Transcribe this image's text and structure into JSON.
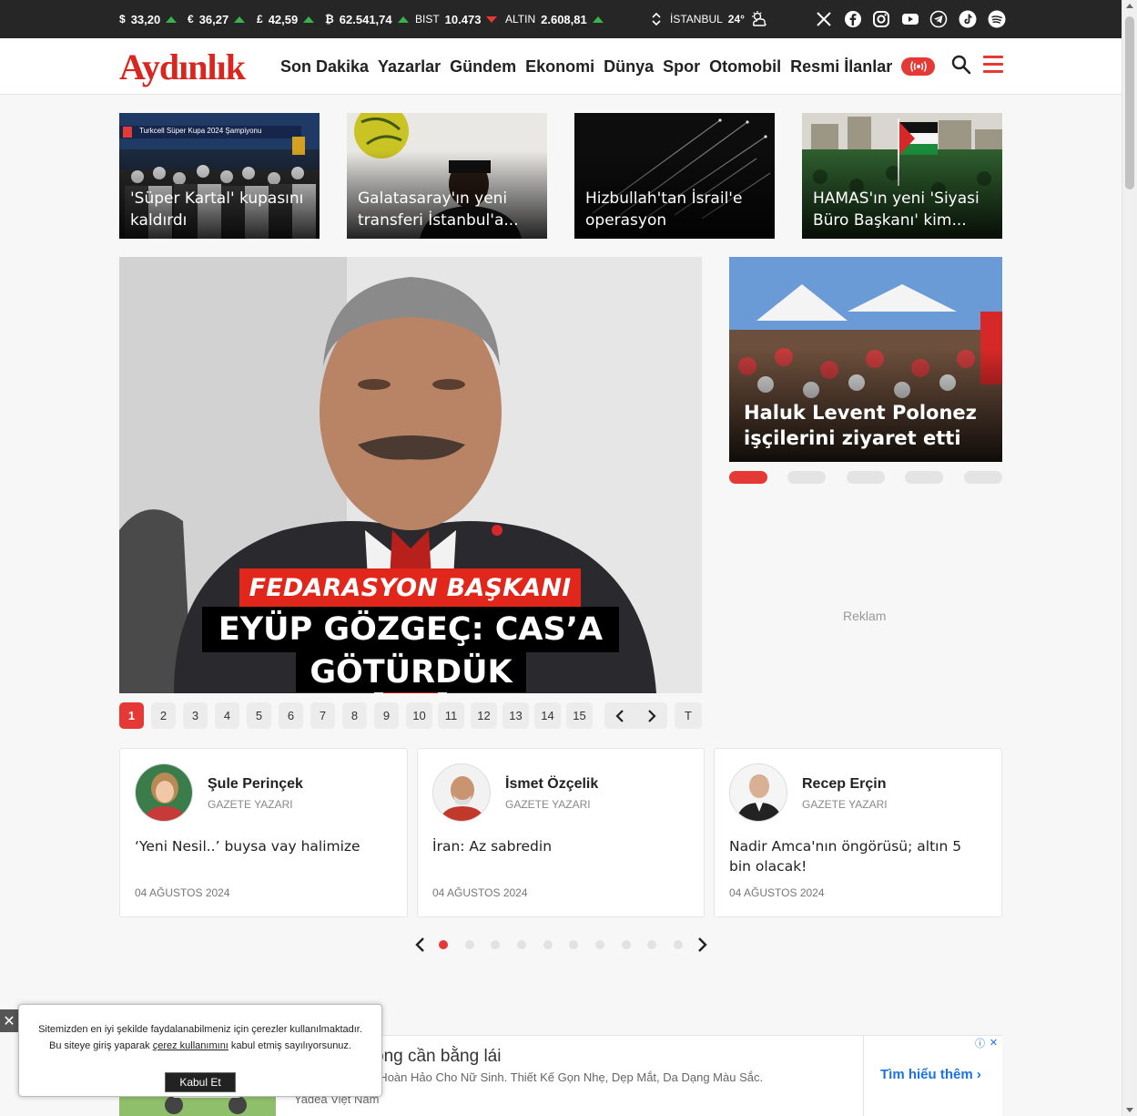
{
  "ticker": {
    "usd": {
      "symbol": "$",
      "value": "33,20",
      "trend": "up"
    },
    "eur": {
      "symbol": "€",
      "value": "36,27",
      "trend": "up"
    },
    "gbp": {
      "symbol": "£",
      "value": "42,59",
      "trend": "up"
    },
    "btc": {
      "symbol": "₿",
      "value": "62.541,74",
      "trend": "up"
    },
    "bist": {
      "label": "BIST",
      "value": "10.473",
      "trend": "down"
    },
    "gold": {
      "label": "ALTIN",
      "value": "2.608,81",
      "trend": "up"
    },
    "weather": {
      "city": "İSTANBUL",
      "temp": "24°"
    },
    "socials": [
      "x-icon",
      "facebook-icon",
      "instagram-icon",
      "youtube-icon",
      "telegram-icon",
      "tiktok-icon",
      "spotify-icon"
    ]
  },
  "header": {
    "logo": "Aydınlık",
    "nav": [
      "Son Dakika",
      "Yazarlar",
      "Gündem",
      "Ekonomi",
      "Dünya",
      "Spor",
      "Otomobil",
      "Resmi İlanlar"
    ]
  },
  "cards": [
    {
      "title": "'Süper Kartal' kupasını kaldırdı",
      "overlay_text": "Turkcell Süper Kupa 2024 Şampiyonu"
    },
    {
      "title": "Galatasaray'ın yeni transferi İstanbul'a..."
    },
    {
      "title": "Hizbullah'tan İsrail'e operasyon"
    },
    {
      "title": "HAMAS'ın yeni 'Siyasi Büro Başkanı' kim..."
    }
  ],
  "hero": {
    "kicker": "FEDARASYON BAŞKANI",
    "line1": "EYÜP GÖZGEÇ: CAS’A",
    "line2": "GÖTÜRDÜK"
  },
  "pager": {
    "pages": [
      "1",
      "2",
      "3",
      "4",
      "5",
      "6",
      "7",
      "8",
      "9",
      "10",
      "11",
      "12",
      "13",
      "14",
      "15"
    ],
    "active": "1",
    "all_label": "T"
  },
  "side": {
    "title": "Haluk Levent Polonez işçilerini ziyaret etti",
    "slides": 5,
    "active": 1
  },
  "ad_label": "Reklam",
  "writers": [
    {
      "name": "Şule Perinçek",
      "role": "GAZETE YAZARI",
      "headline": "‘Yeni Nesil..’ buysa vay halimize",
      "date": "04 AĞUSTOS 2024"
    },
    {
      "name": "İsmet Özçelik",
      "role": "GAZETE YAZARI",
      "headline": "İran: Az sabredin",
      "date": "04 AĞUSTOS 2024"
    },
    {
      "name": "Recep Erçin",
      "role": "GAZETE YAZARI",
      "headline": "Nadir Amca'nın öngörüsü; altın 5 bin olacak!",
      "date": "04 AĞUSTOS 2024"
    }
  ],
  "writer_slider": {
    "dots": 10,
    "active": 1
  },
  "banner": {
    "title": "ong cần bằng lái",
    "desc": "họn Hoàn Hảo Cho Nữ Sinh. Thiết Kế Gọn Nhẹ, Dẹp Mắt, Da Dạng Màu Sắc.",
    "source": "Yadea Việt Nam",
    "cta": "Tìm hiểu thêm"
  },
  "cookie": {
    "text_before": "Sitemizden en iyi şekilde faydalanabilmeniz için çerezler kullanılmaktadır. Bu siteye giriş yaparak ",
    "link": "çerez kullanımını",
    "text_after": " kabul etmiş sayılıyorsunuz.",
    "button": "Kabul Et"
  },
  "colors": {
    "accent": "#e53935",
    "dark": "#262626",
    "up": "#36b34a",
    "down": "#e53935"
  }
}
